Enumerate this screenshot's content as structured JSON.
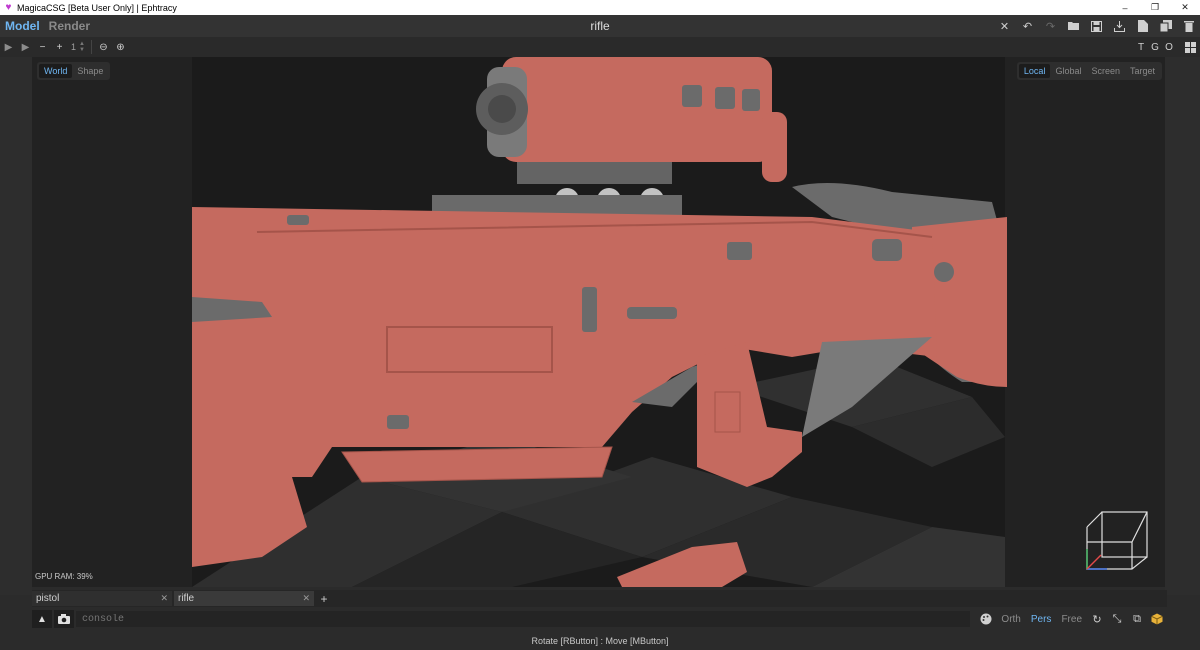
{
  "window": {
    "title": "MagicaCSG [Beta User Only] | Ephtracy",
    "controls": [
      "–",
      "❐",
      "✕"
    ]
  },
  "appbar": {
    "modes": [
      {
        "label": "Model",
        "active": true
      },
      {
        "label": "Render",
        "active": false
      }
    ],
    "document_title": "rifle",
    "tools": [
      "close-icon",
      "undo-icon",
      "redo-icon",
      "open-icon",
      "save-icon",
      "export-icon",
      "new-file-icon",
      "duplicate-icon",
      "delete-icon"
    ]
  },
  "toolrow": {
    "stepper_value": "1",
    "right_letters": [
      "T",
      "G",
      "O"
    ]
  },
  "viewport": {
    "space_left": [
      {
        "label": "World",
        "active": true
      },
      {
        "label": "Shape",
        "active": false
      }
    ],
    "space_right": [
      {
        "label": "Local",
        "active": true
      },
      {
        "label": "Global",
        "active": false
      },
      {
        "label": "Screen",
        "active": false
      },
      {
        "label": "Target",
        "active": false
      }
    ],
    "gpu_ram": "GPU RAM: 39%",
    "colors": {
      "model": "#c56a5f",
      "metal": "#6b6b6b",
      "floor_dark": "#262626",
      "floor_light": "#323232"
    }
  },
  "tabs": [
    {
      "label": "pistol",
      "active": false
    },
    {
      "label": "rifle",
      "active": true
    }
  ],
  "add_tab_label": "+",
  "console": {
    "placeholder": "console",
    "view_modes": [
      {
        "label": "Orth",
        "active": false
      },
      {
        "label": "Pers",
        "active": true
      },
      {
        "label": "Free",
        "active": false
      }
    ]
  },
  "status": {
    "hint": "Rotate [RButton] : Move [MButton]"
  },
  "colors": {
    "accent": "#6fb6f2",
    "background": "#2b2b2b"
  }
}
